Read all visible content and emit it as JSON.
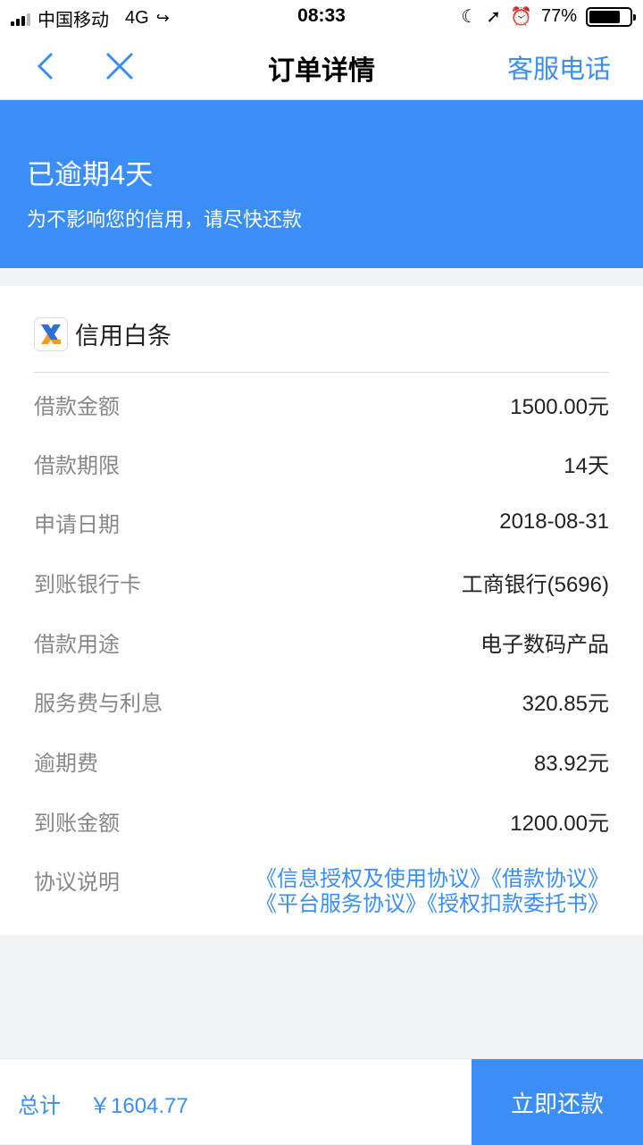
{
  "status_bar": {
    "carrier": "中国移动",
    "network": "4G",
    "time": "08:33",
    "battery_percent": "77%",
    "battery_level": 0.77
  },
  "nav": {
    "title": "订单详情",
    "action": "客服电话"
  },
  "banner": {
    "title": "已逾期4天",
    "subtitle": "为不影响您的信用，请尽快还款"
  },
  "product": {
    "name": "信用白条"
  },
  "details": [
    {
      "label": "借款金额",
      "value": "1500.00元"
    },
    {
      "label": "借款期限",
      "value": "14天"
    },
    {
      "label": "申请日期",
      "value": "2018-08-31"
    },
    {
      "label": "到账银行卡",
      "value": "工商银行(5696)"
    },
    {
      "label": "借款用途",
      "value": "电子数码产品"
    },
    {
      "label": "服务费与利息",
      "value": "320.85元"
    },
    {
      "label": "逾期费",
      "value": "83.92元"
    },
    {
      "label": "到账金额",
      "value": "1200.00元"
    }
  ],
  "agreements": {
    "label": "协议说明",
    "links": [
      "《信息授权及使用协议》",
      "《借款协议》",
      "《平台服务协议》",
      "《授权扣款委托书》"
    ]
  },
  "footer": {
    "total_label": "总计",
    "total_value": "￥1604.77",
    "pay_button": "立即还款"
  },
  "colors": {
    "accent": "#3a8ef6",
    "background": "#f2f3f5"
  }
}
